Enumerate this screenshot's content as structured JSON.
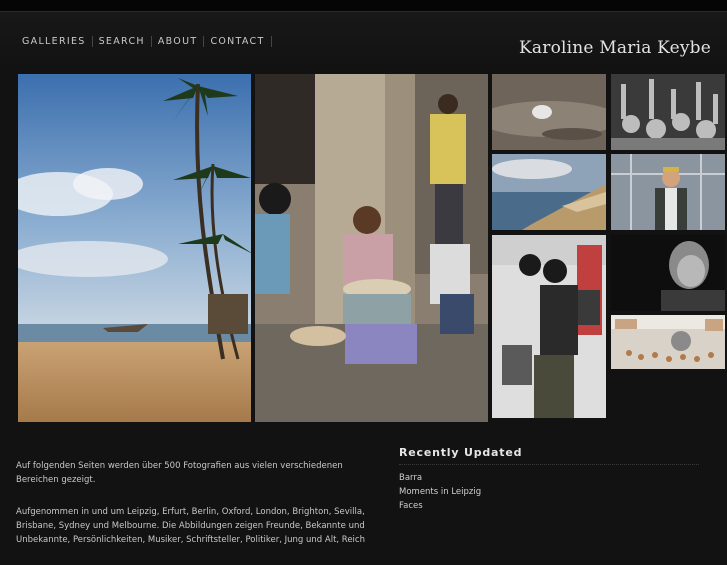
{
  "nav": {
    "items": [
      {
        "label": "GALLERIES"
      },
      {
        "label": "SEARCH"
      },
      {
        "label": "ABOUT"
      },
      {
        "label": "CONTACT"
      }
    ]
  },
  "site_title": "Karoline Maria Keybe",
  "intro": {
    "paragraph1": "Auf folgenden Seiten werden über 500 Fotografien aus vielen verschiedenen Bereichen gezeigt.",
    "paragraph2": "Aufgenommen in und um Leipzig, Erfurt, Berlin, Oxford, London, Brighton, Sevilla, Brisbane, Sydney und Melbourne. Die Abbildungen zeigen Freunde, Bekannte und Unbekannte, Persönlichkeiten, Musiker, Schriftsteller, Politiker, Jung und Alt, Reich"
  },
  "recently_updated": {
    "heading": "Recently Updated",
    "items": [
      {
        "label": "Barra"
      },
      {
        "label": "Moments in Leipzig"
      },
      {
        "label": "Faces"
      }
    ]
  }
}
